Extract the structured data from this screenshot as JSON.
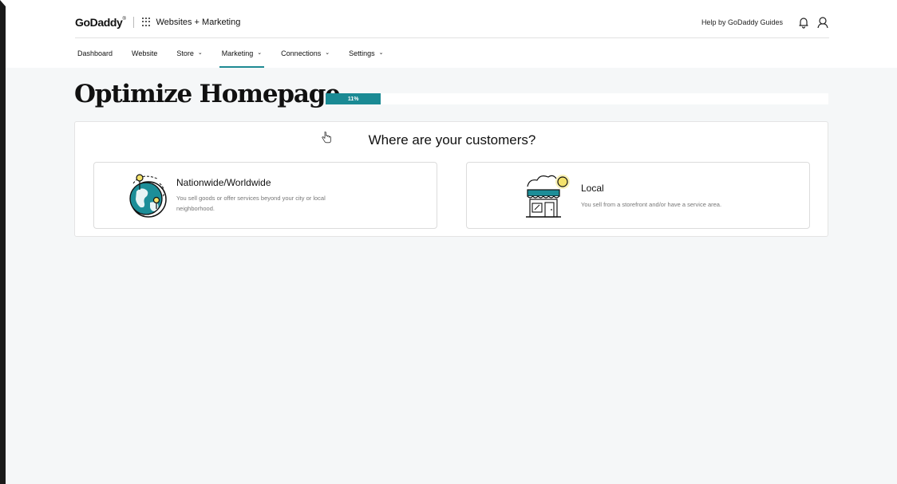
{
  "brand": {
    "logo_text": "GoDaddy",
    "logo_mark": "®",
    "product": "Websites + Marketing"
  },
  "topbar": {
    "help_link": "Help by GoDaddy Guides",
    "icons": [
      "bell-icon",
      "user-icon",
      "apps-grid-icon"
    ]
  },
  "nav": {
    "items": [
      {
        "label": "Dashboard",
        "dropdown": false,
        "active": false
      },
      {
        "label": "Website",
        "dropdown": false,
        "active": false
      },
      {
        "label": "Store",
        "dropdown": true,
        "active": false
      },
      {
        "label": "Marketing",
        "dropdown": true,
        "active": true
      },
      {
        "label": "Connections",
        "dropdown": true,
        "active": false
      },
      {
        "label": "Settings",
        "dropdown": true,
        "active": false
      }
    ]
  },
  "page": {
    "title": "Optimize Homepage",
    "progress": {
      "value": 0.11,
      "label": "11%"
    }
  },
  "question": {
    "text": "Where are your customers?",
    "options": [
      {
        "title": "Nationwide/Worldwide",
        "description": "You sell goods or offer services beyond your city or local neighborhood.",
        "icon": "globe-icon"
      },
      {
        "title": "Local",
        "description": "You sell from a storefront and/or have a service area.",
        "icon": "storefront-icon"
      }
    ]
  },
  "colors": {
    "accent": "#1a8a94",
    "background": "#f5f7f8",
    "card": "#ffffff",
    "highlight": "#f4e26b"
  }
}
